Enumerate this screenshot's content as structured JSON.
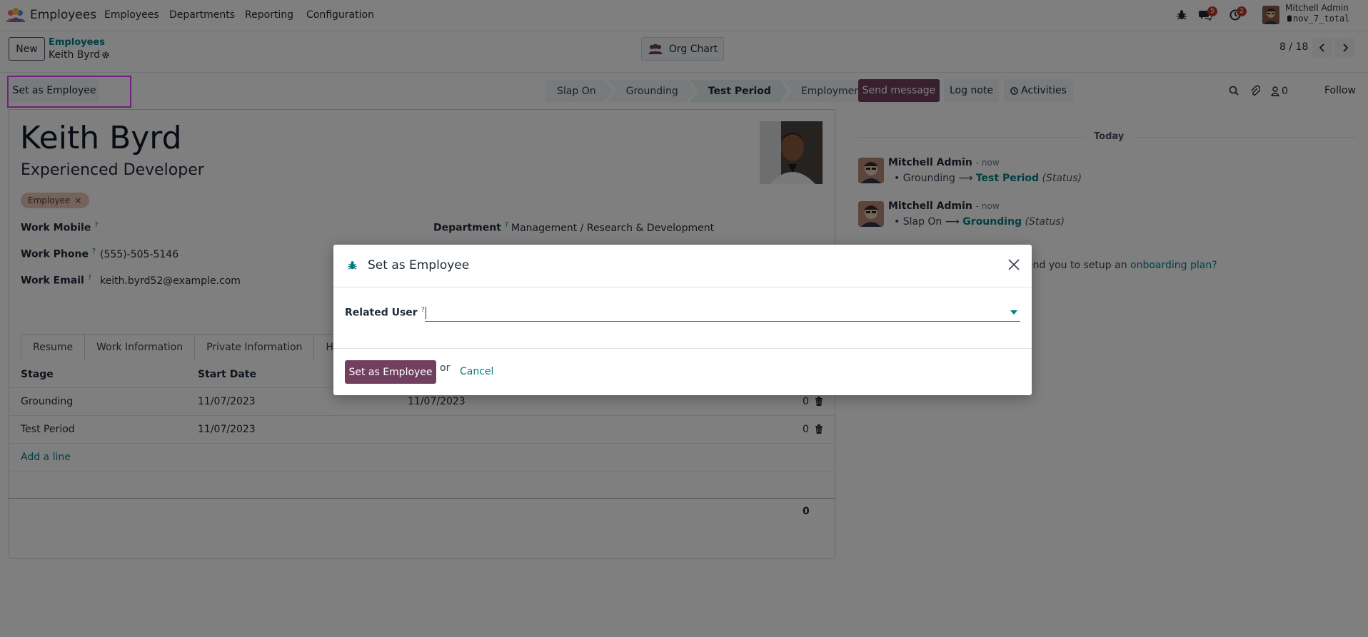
{
  "navbar": {
    "app_name": "Employees",
    "menu": [
      "Employees",
      "Departments",
      "Reporting",
      "Configuration"
    ],
    "chat_badge": "5",
    "activity_badge": "2",
    "user_name": "Mitchell Admin",
    "db_name": "nov_7_total"
  },
  "control_panel": {
    "new_label": "New",
    "breadcrumb_parent": "Employees",
    "breadcrumb_current": "Keith Byrd",
    "org_chart_label": "Org Chart",
    "pager": "8 / 18"
  },
  "statusbar": {
    "action_label": "Set as Employee",
    "stages": [
      "Slap On",
      "Grounding",
      "Test Period",
      "Employment"
    ],
    "active_stage": "Test Period"
  },
  "employee": {
    "name": "Keith Byrd",
    "job_title": "Experienced Developer",
    "tag": "Employee",
    "tag_remove": "×",
    "fields": {
      "work_mobile_label": "Work Mobile",
      "work_phone_label": "Work Phone",
      "work_phone": "(555)-505-5146",
      "work_email_label": "Work Email",
      "work_email": "keith.byrd52@example.com",
      "department_label": "Department",
      "department": "Management / Research & Development",
      "help_mark": "?"
    }
  },
  "tabs": [
    "Resume",
    "Work Information",
    "Private Information",
    "HR Se"
  ],
  "table": {
    "headers": {
      "stage": "Stage",
      "start_date": "Start Date"
    },
    "rows": [
      {
        "stage": "Grounding",
        "start": "11/07/2023",
        "end": "11/07/2023",
        "count": "0"
      },
      {
        "stage": "Test Period",
        "start": "11/07/2023",
        "end": "",
        "count": "0"
      }
    ],
    "add_line": "Add a line",
    "total": "0"
  },
  "chatter": {
    "send_message": "Send message",
    "log_note": "Log note",
    "activities": "Activities",
    "followers_count": "0",
    "follow": "Follow",
    "today": "Today",
    "messages": [
      {
        "author": "Mitchell Admin",
        "time": "- now",
        "old": "Grounding",
        "arrow": "⟶",
        "new": "Test Period",
        "field": "(Status)"
      },
      {
        "author": "Mitchell Admin",
        "time": "- now",
        "old": "Slap On",
        "arrow": "⟶",
        "new": "Grounding",
        "field": "(Status)"
      }
    ],
    "onboarding_text": "end you to setup an",
    "onboarding_link": "onboarding plan?"
  },
  "modal": {
    "title": "Set as Employee",
    "related_user_label": "Related User",
    "help_mark": "?",
    "related_user_value": "",
    "primary_label": "Set as Employee",
    "or_text": "or",
    "cancel_label": "Cancel"
  }
}
